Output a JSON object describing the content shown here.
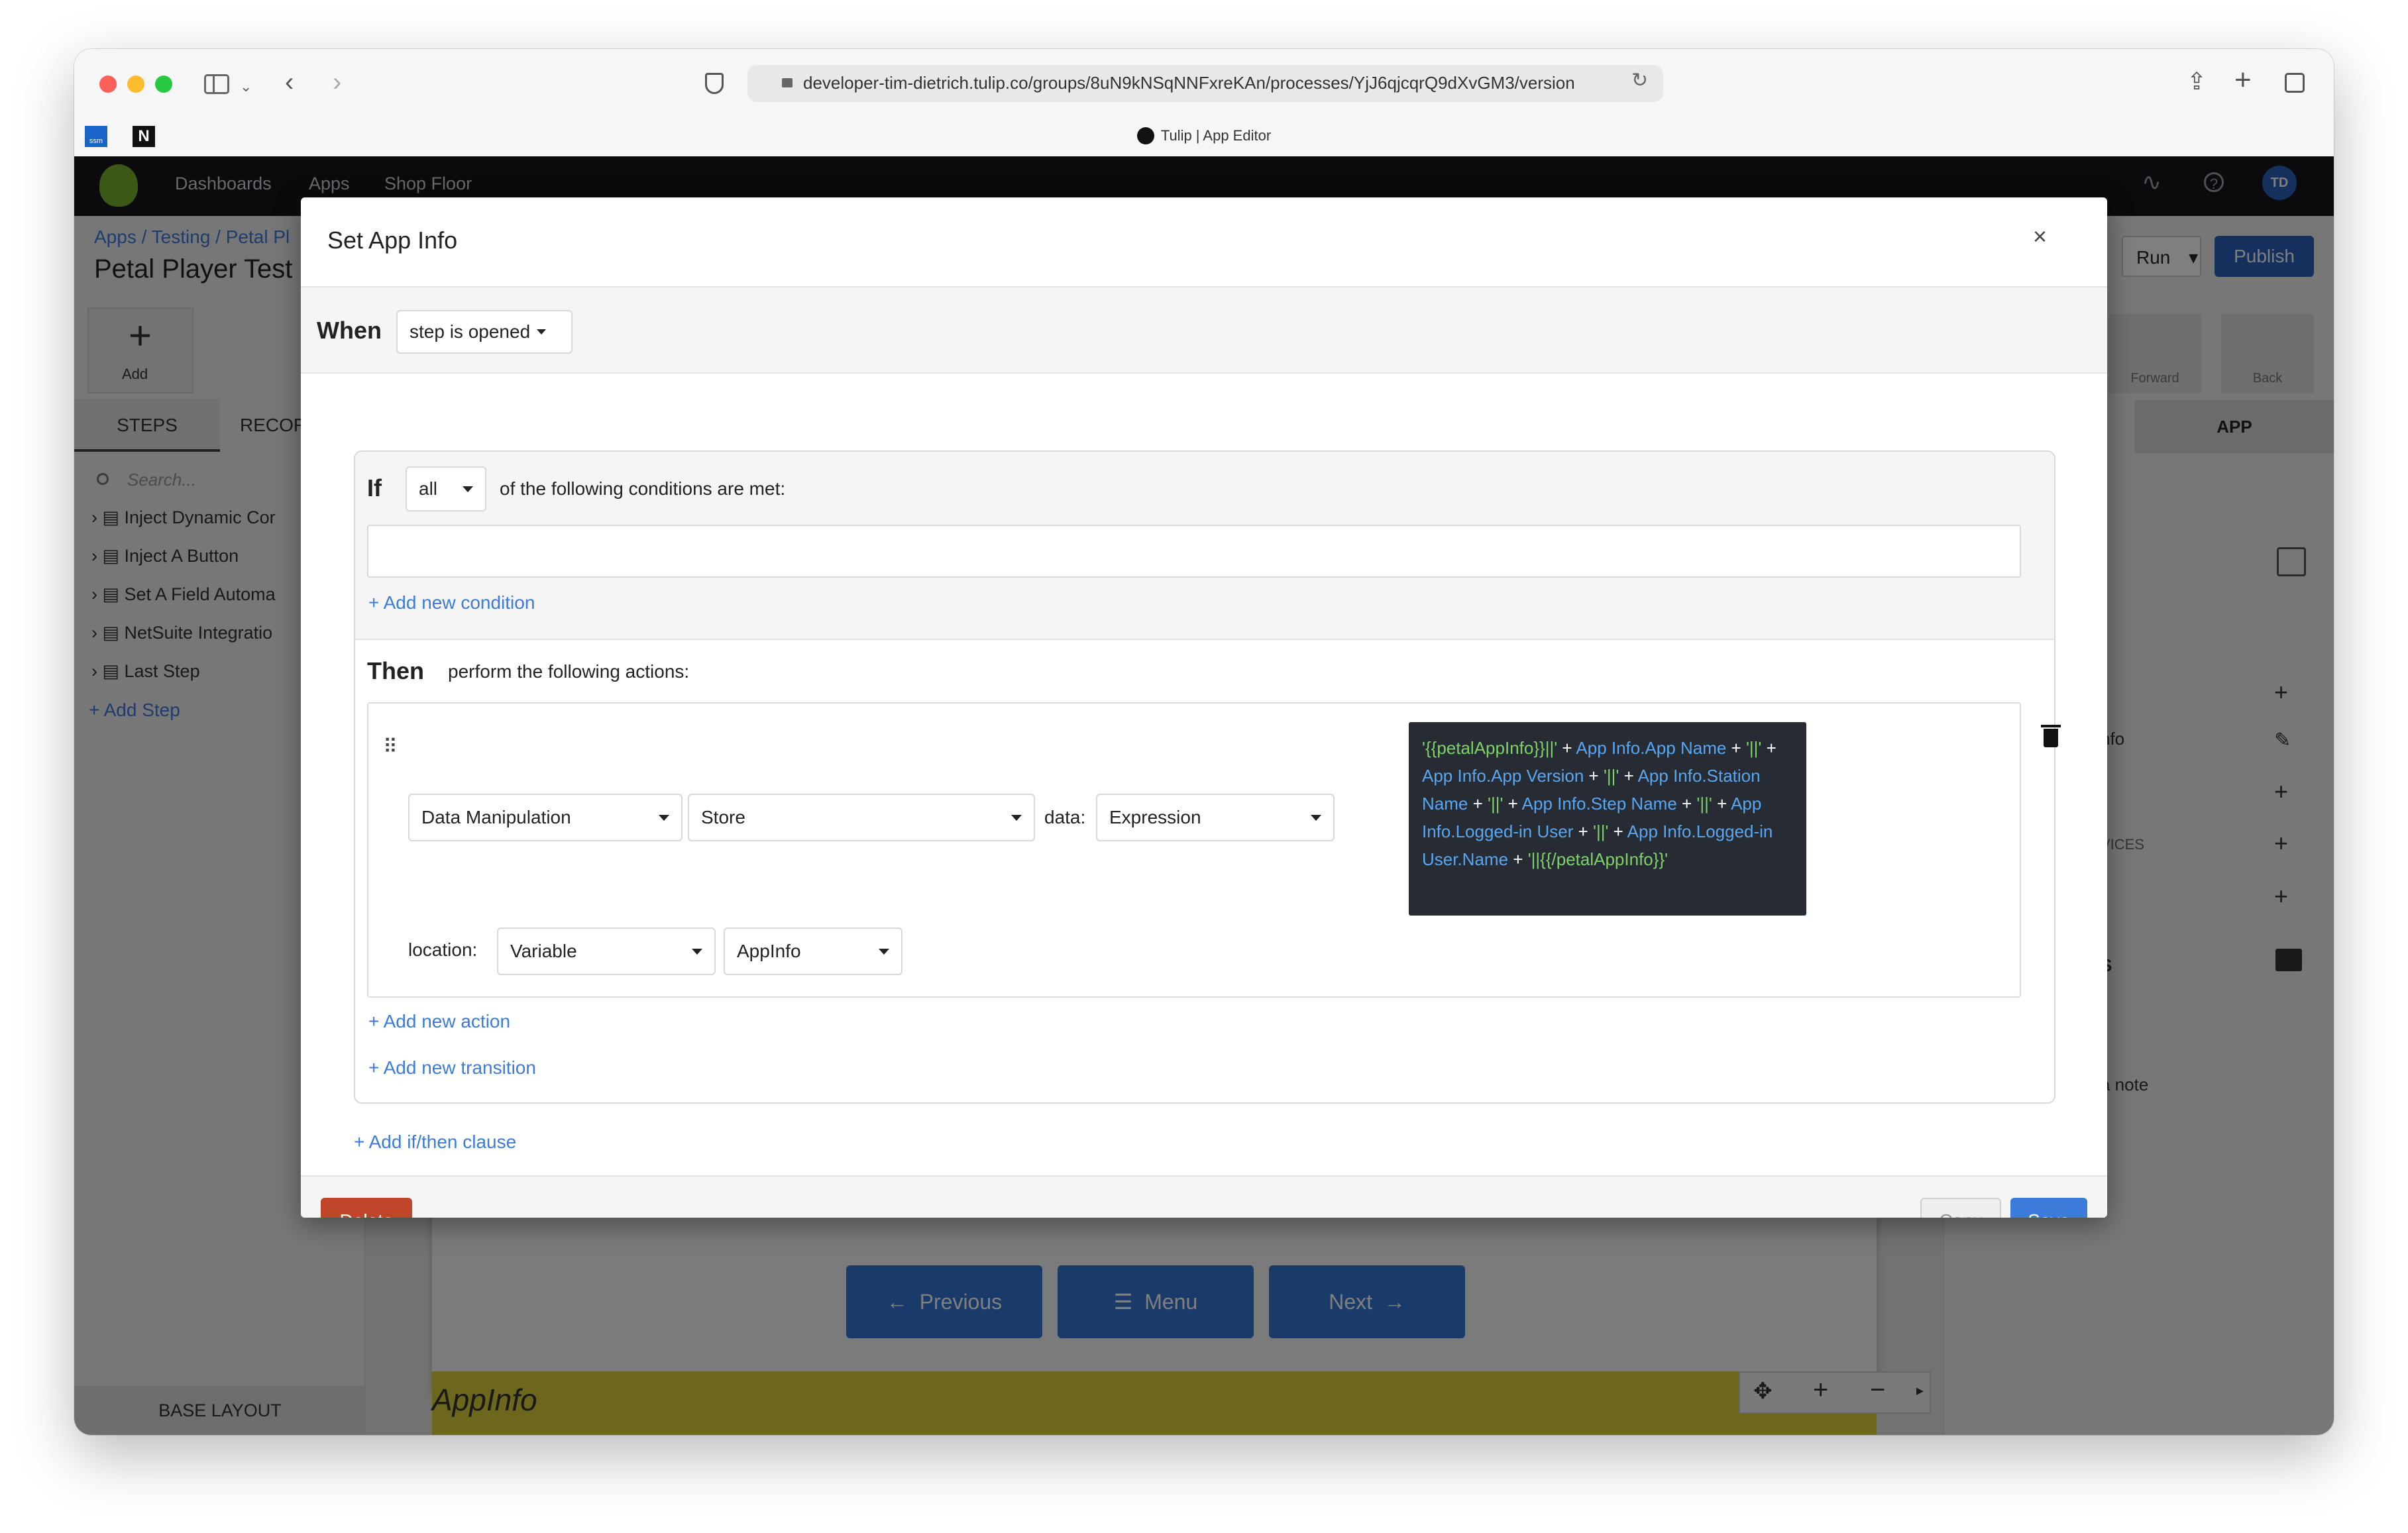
{
  "browser": {
    "url": "developer-tim-dietrich.tulip.co/groups/8uN9kNSqNNFxreKAn/processes/YjJ6qjcqrQ9dXvGM3/version",
    "tab_title": "Tulip | App Editor",
    "bookmarks": [
      "ssm",
      "N"
    ]
  },
  "app_nav": {
    "items": [
      "Dashboards",
      "Apps",
      "Shop Floor"
    ],
    "avatar": "TD"
  },
  "background": {
    "breadcrumb": [
      "Apps",
      "Testing",
      "Petal Pl"
    ],
    "page_title": "Petal Player Test",
    "add_label": "Add",
    "tabs": [
      "STEPS",
      "RECOR"
    ],
    "search_placeholder": "Search...",
    "steps": [
      "Inject Dynamic Cor",
      "Inject A Button",
      "Set A Field Automa",
      "NetSuite Integratio",
      "Last Step"
    ],
    "add_step": "Add Step",
    "base_layout": "BASE LAYOUT",
    "run_label": "Run",
    "publish_label": "Publish",
    "forward_label": "Forward",
    "back_label": "Back",
    "app_tab": "APP",
    "right_fragments": [
      "nfo",
      "VICES",
      "S",
      "a note"
    ],
    "buttons": [
      "Previous",
      "Menu",
      "Next"
    ],
    "variable_label": "AppInfo"
  },
  "modal": {
    "title": "Set App Info",
    "close": "×",
    "when_label": "When",
    "trigger": "step is opened",
    "if_label": "If",
    "condition_mode": "all",
    "conditions_text": "of the following conditions are met:",
    "add_condition": "Add new condition",
    "then_label": "Then",
    "then_text": "perform the following actions:",
    "action": {
      "type": "Data Manipulation",
      "operation": "Store",
      "data_label": "data:",
      "data_type": "Expression",
      "location_label": "location:",
      "location_type": "Variable",
      "variable": "AppInfo",
      "expression": [
        {
          "t": "'{{petalAppInfo}}||'",
          "c": "g"
        },
        {
          "t": " + ",
          "c": "w"
        },
        {
          "t": "App Info.App Name",
          "c": "b"
        },
        {
          "t": " + ",
          "c": "w"
        },
        {
          "t": "'||'",
          "c": "g"
        },
        {
          "t": " + ",
          "c": "w"
        },
        {
          "t": "App Info.App Version",
          "c": "b"
        },
        {
          "t": " + ",
          "c": "w"
        },
        {
          "t": "'||'",
          "c": "g"
        },
        {
          "t": " + ",
          "c": "w"
        },
        {
          "t": "App Info.Station Name",
          "c": "b"
        },
        {
          "t": " + ",
          "c": "w"
        },
        {
          "t": "'||'",
          "c": "g"
        },
        {
          "t": " + ",
          "c": "w"
        },
        {
          "t": "App Info.Step Name",
          "c": "b"
        },
        {
          "t": " + ",
          "c": "w"
        },
        {
          "t": "'||'",
          "c": "g"
        },
        {
          "t": " + ",
          "c": "w"
        },
        {
          "t": "App Info.Logged-in User",
          "c": "b"
        },
        {
          "t": " + ",
          "c": "w"
        },
        {
          "t": "'||'",
          "c": "g"
        },
        {
          "t": " + ",
          "c": "w"
        },
        {
          "t": "App Info.Logged-in User.Name",
          "c": "b"
        },
        {
          "t": " + ",
          "c": "w"
        },
        {
          "t": "'||{{/petalAppInfo}}'",
          "c": "g"
        }
      ]
    },
    "add_action": "Add new action",
    "add_transition": "Add new transition",
    "add_clause": "Add if/then clause",
    "delete_label": "Delete",
    "copy_label": "Copy",
    "save_label": "Save"
  },
  "colors": {
    "nav_bg": "#16171c",
    "primary": "#3c7bd9",
    "delete": "#c0462b",
    "expression_bg": "#272c34",
    "variable_highlight": "#d8cf3a"
  }
}
